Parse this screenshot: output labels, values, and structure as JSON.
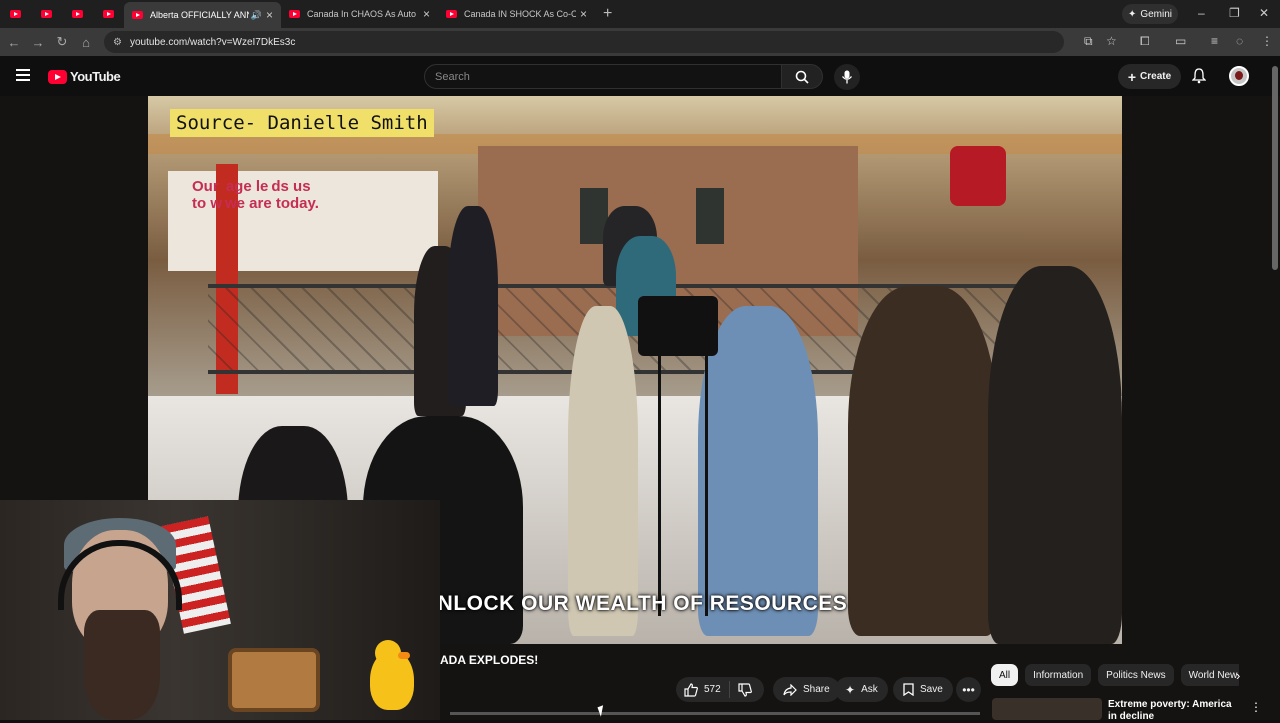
{
  "browser": {
    "tabs": [
      {
        "title": "Alberta OFFICIALLY ANNOU",
        "active": true
      },
      {
        "title": "Canada In CHAOS As Auto Ma",
        "active": false
      },
      {
        "title": "Canada IN SHOCK As Co-Op Cl",
        "active": false
      }
    ],
    "gemini_label": "Gemini",
    "url": "youtube.com/watch?v=WzeI7DkEs3c"
  },
  "youtube": {
    "logo_text": "YouTube",
    "search_placeholder": "Search",
    "create_label": "Create"
  },
  "video": {
    "source_label": "Source- Danielle Smith",
    "sign_text": "Our  age le ds us\nto w we are today.",
    "caption": "UNLOCK OUR WEALTH OF RESOURCES",
    "title_visible": "ADA EXPLODES!"
  },
  "actions": {
    "like_count": "572",
    "share_label": "Share",
    "ask_label": "Ask",
    "save_label": "Save"
  },
  "chips": [
    "All",
    "Information",
    "Politics News",
    "World New"
  ],
  "recommendation": {
    "title": "Extreme poverty: America in decline"
  },
  "colors": {
    "brand_red": "#ff0033",
    "source_label_bg": "#f0e06a"
  }
}
